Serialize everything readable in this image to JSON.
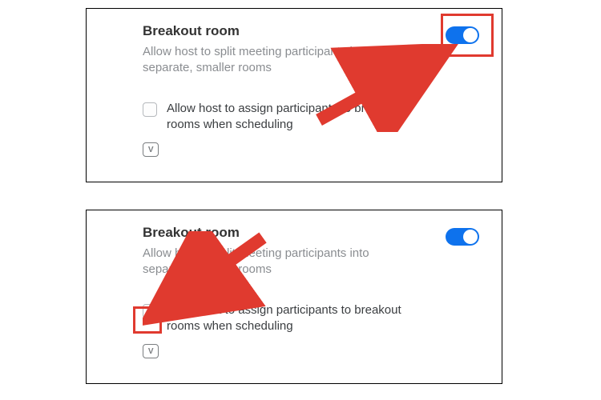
{
  "panels": [
    {
      "title": "Breakout room",
      "description": "Allow host to split meeting participants into separate, smaller rooms",
      "toggle_on": true,
      "option_label": "Allow host to assign participants to breakout rooms when scheduling",
      "option_checked": false,
      "badge": "V"
    },
    {
      "title": "Breakout room",
      "description": "Allow host to split meeting participants into separate, smaller rooms",
      "toggle_on": true,
      "option_label": "Allow host to assign participants to breakout rooms when scheduling",
      "option_checked": false,
      "badge": "V"
    }
  ],
  "annotation_color": "#e03a2f",
  "toggle_color": "#0e72ed"
}
